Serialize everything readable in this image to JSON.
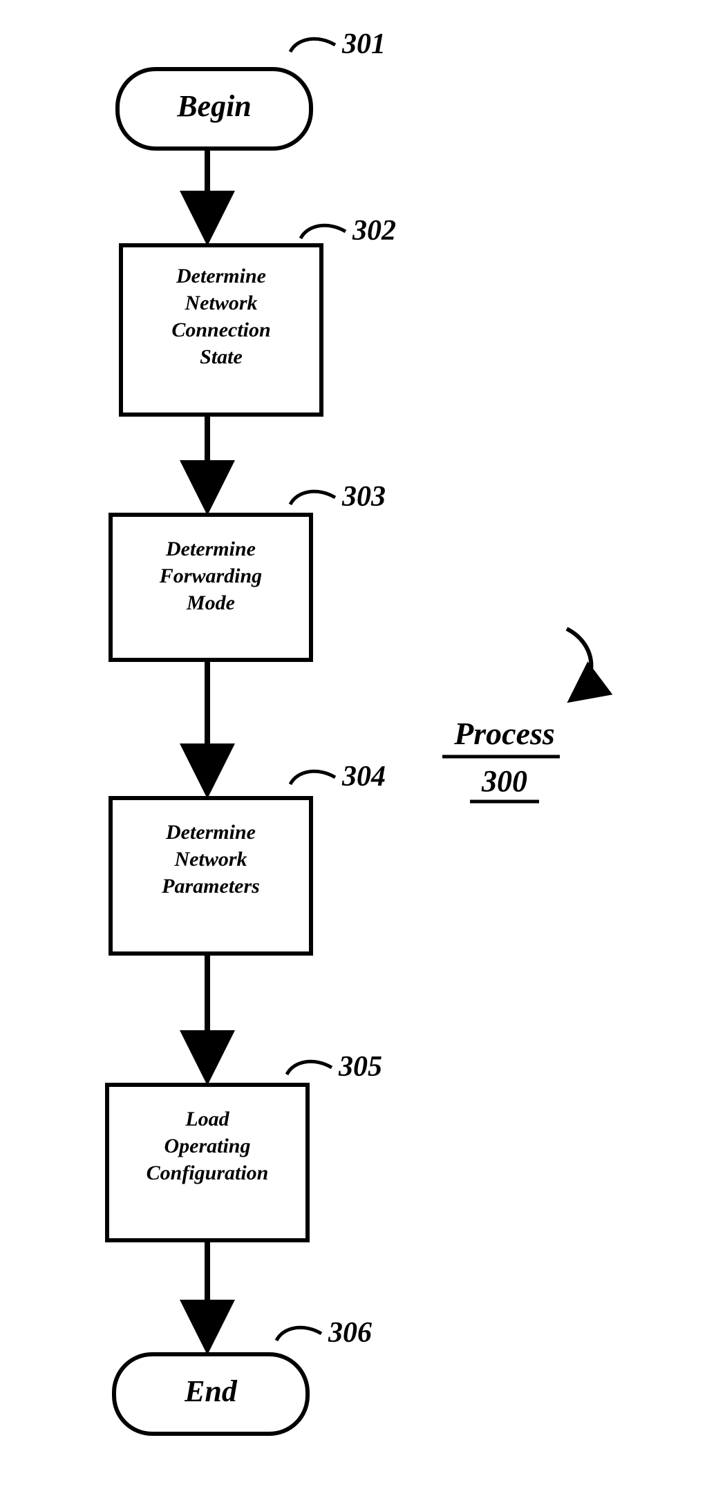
{
  "process": {
    "name": "Process",
    "number": "300"
  },
  "nodes": {
    "n301": {
      "ref": "301",
      "text": "Begin"
    },
    "n302": {
      "ref": "302",
      "lines": [
        "Determine",
        "Network",
        "Connection",
        "State"
      ]
    },
    "n303": {
      "ref": "303",
      "lines": [
        "Determine",
        "Forwarding",
        "Mode"
      ]
    },
    "n304": {
      "ref": "304",
      "lines": [
        "Determine",
        "Network",
        "Parameters"
      ]
    },
    "n305": {
      "ref": "305",
      "lines": [
        "Load",
        "Operating",
        "Configuration"
      ]
    },
    "n306": {
      "ref": "306",
      "text": "End"
    }
  }
}
